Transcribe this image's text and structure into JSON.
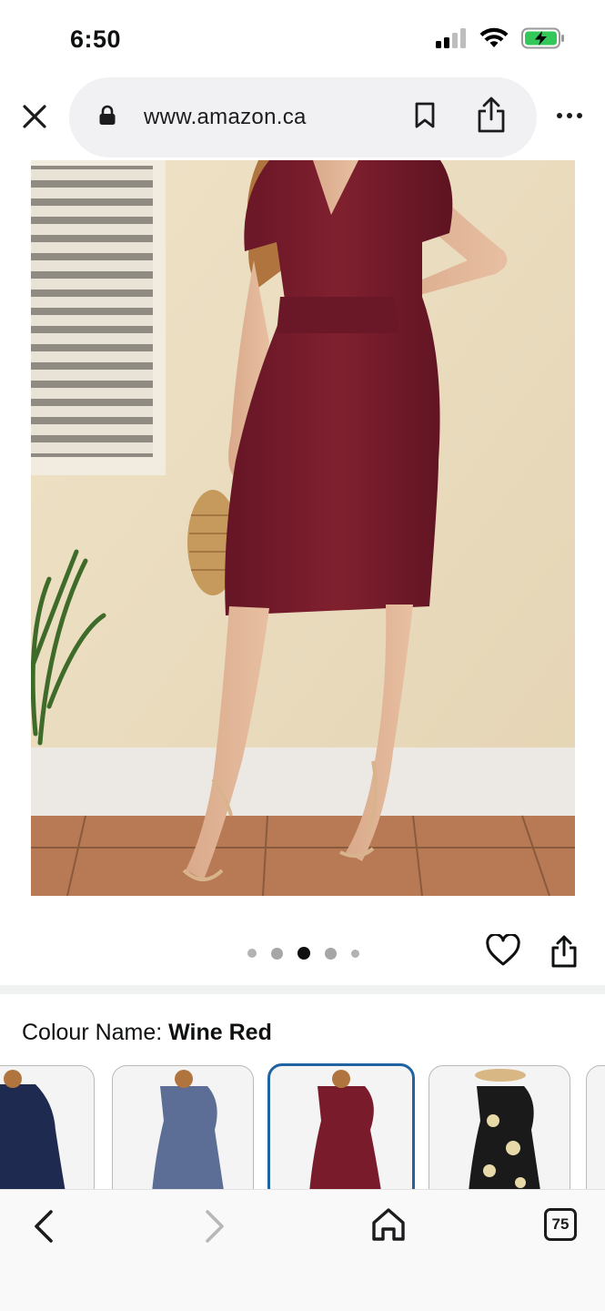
{
  "status_bar": {
    "time": "6:50"
  },
  "browser": {
    "url": "www.amazon.ca",
    "tab_count": "75"
  },
  "product": {
    "image_alt": "Wine red wrap dress",
    "carousel": {
      "total": 5,
      "active_index": 2
    }
  },
  "colour": {
    "label": "Colour Name: ",
    "value": "Wine Red",
    "swatches": [
      {
        "name": "navy",
        "color": "#1e2a4f"
      },
      {
        "name": "blue-grey",
        "color": "#5c6e95"
      },
      {
        "name": "wine-red",
        "color": "#7a1b2c",
        "selected": true
      },
      {
        "name": "black-floral",
        "color": "#1a1a1a"
      },
      {
        "name": "partial",
        "color": "#e8e8e8"
      }
    ]
  },
  "colors": {
    "accent": "#2162a1",
    "dress": "#7a1b2c",
    "battery": "#34c759"
  }
}
